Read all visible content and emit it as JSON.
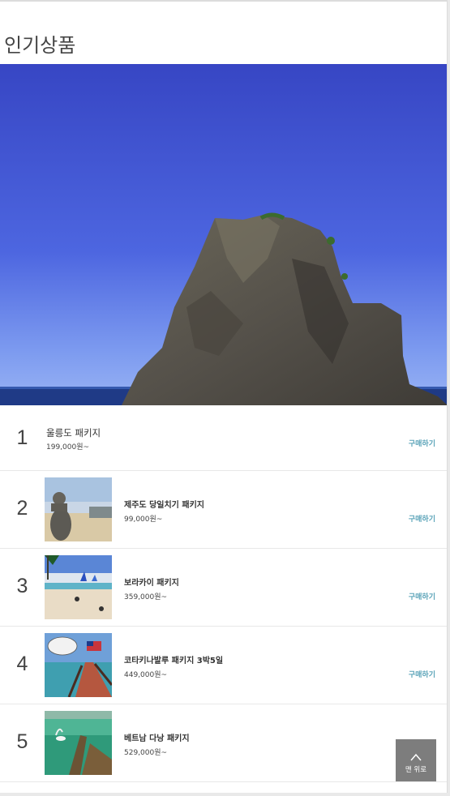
{
  "section": {
    "title": "인기상품"
  },
  "hero": {
    "image": "rock-island-sea-photo"
  },
  "products": [
    {
      "rank": "1",
      "name": "울릉도 패키지",
      "price": "199,000원~",
      "buy_label": "구매하기",
      "thumb": null
    },
    {
      "rank": "2",
      "name": "제주도 당일치기 패키지",
      "price": "99,000원~",
      "buy_label": "구매하기",
      "thumb": "jeju-statue-beach-photo"
    },
    {
      "rank": "3",
      "name": "보라카이 패키지",
      "price": "359,000원~",
      "buy_label": "구매하기",
      "thumb": "boracay-beach-sailboats-photo"
    },
    {
      "rank": "4",
      "name": "코타키나발루 패키지 3박5일",
      "price": "449,000원~",
      "buy_label": "구매하기",
      "thumb": "kota-kinabalu-pier-photo"
    },
    {
      "rank": "5",
      "name": "베트남 다낭 패키지",
      "price": "529,000원~",
      "buy_label": null,
      "thumb": "vietnam-boats-water-photo"
    }
  ],
  "scroll_top": {
    "label": "맨 위로",
    "icon": "chevron-up-icon"
  },
  "colors": {
    "buy_accent": "#5aa3b8",
    "top_button_bg": "#7d7d7d"
  }
}
